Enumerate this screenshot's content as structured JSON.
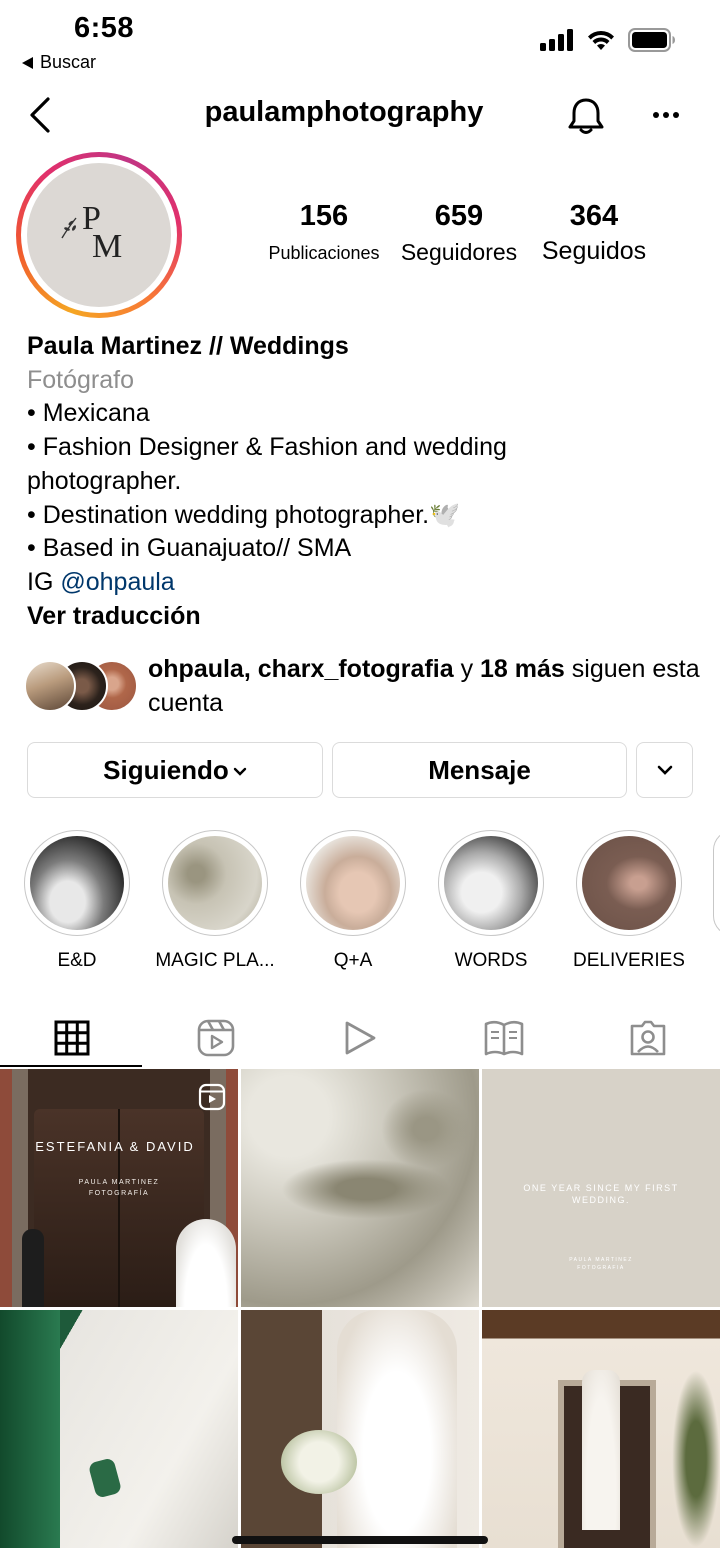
{
  "status_bar": {
    "time": "6:58",
    "back_app": "Buscar"
  },
  "header": {
    "username": "paulamphotography",
    "icons": [
      "back-arrow-icon",
      "bell-icon",
      "more-icon"
    ]
  },
  "profile": {
    "logo_letters": {
      "p": "P",
      "m": "M"
    },
    "stats": [
      {
        "value": "156",
        "label": "Publicaciones"
      },
      {
        "value": "659",
        "label": "Seguidores"
      },
      {
        "value": "364",
        "label": "Seguidos"
      }
    ]
  },
  "bio": {
    "name": "Paula Martinez // Weddings",
    "category": "Fotógrafo",
    "lines": [
      "• Mexicana",
      "• Fashion Designer & Fashion and wedding photographer.",
      "• Destination wedding photographer.🕊️",
      "• Based in Guanajuato// SMA"
    ],
    "ig_prefix": "IG",
    "ig_link": "@ohpaula",
    "translate": "Ver traducción"
  },
  "followed_by": {
    "names": "ohpaula, charx_fotografia",
    "joiner": " y ",
    "more": "18 más",
    "suffix": " siguen esta cuenta"
  },
  "actions": {
    "following": "Siguiendo",
    "message": "Mensaje"
  },
  "highlights": [
    {
      "label": "E&D"
    },
    {
      "label": "MAGIC PLA..."
    },
    {
      "label": "Q+A"
    },
    {
      "label": "WORDS"
    },
    {
      "label": "DELIVERIES"
    }
  ],
  "tabs": [
    "grid-icon",
    "reels-icon",
    "video-icon",
    "guides-icon",
    "tagged-icon"
  ],
  "posts": {
    "p1_title": "ESTEFANIA & DAVID",
    "p1_sub1": "PAULA MARTINEZ",
    "p1_sub2": "FOTOGRAFÍA",
    "p3_title1": "ONE YEAR SINCE MY FIRST",
    "p3_title2": "WEDDING.",
    "p3_sub1": "PAULA MARTINEZ",
    "p3_sub2": "FOTOGRAFIA"
  },
  "colors": {
    "link": "#00376b",
    "muted": "#8e8e8e",
    "border": "#dbdbdb"
  }
}
